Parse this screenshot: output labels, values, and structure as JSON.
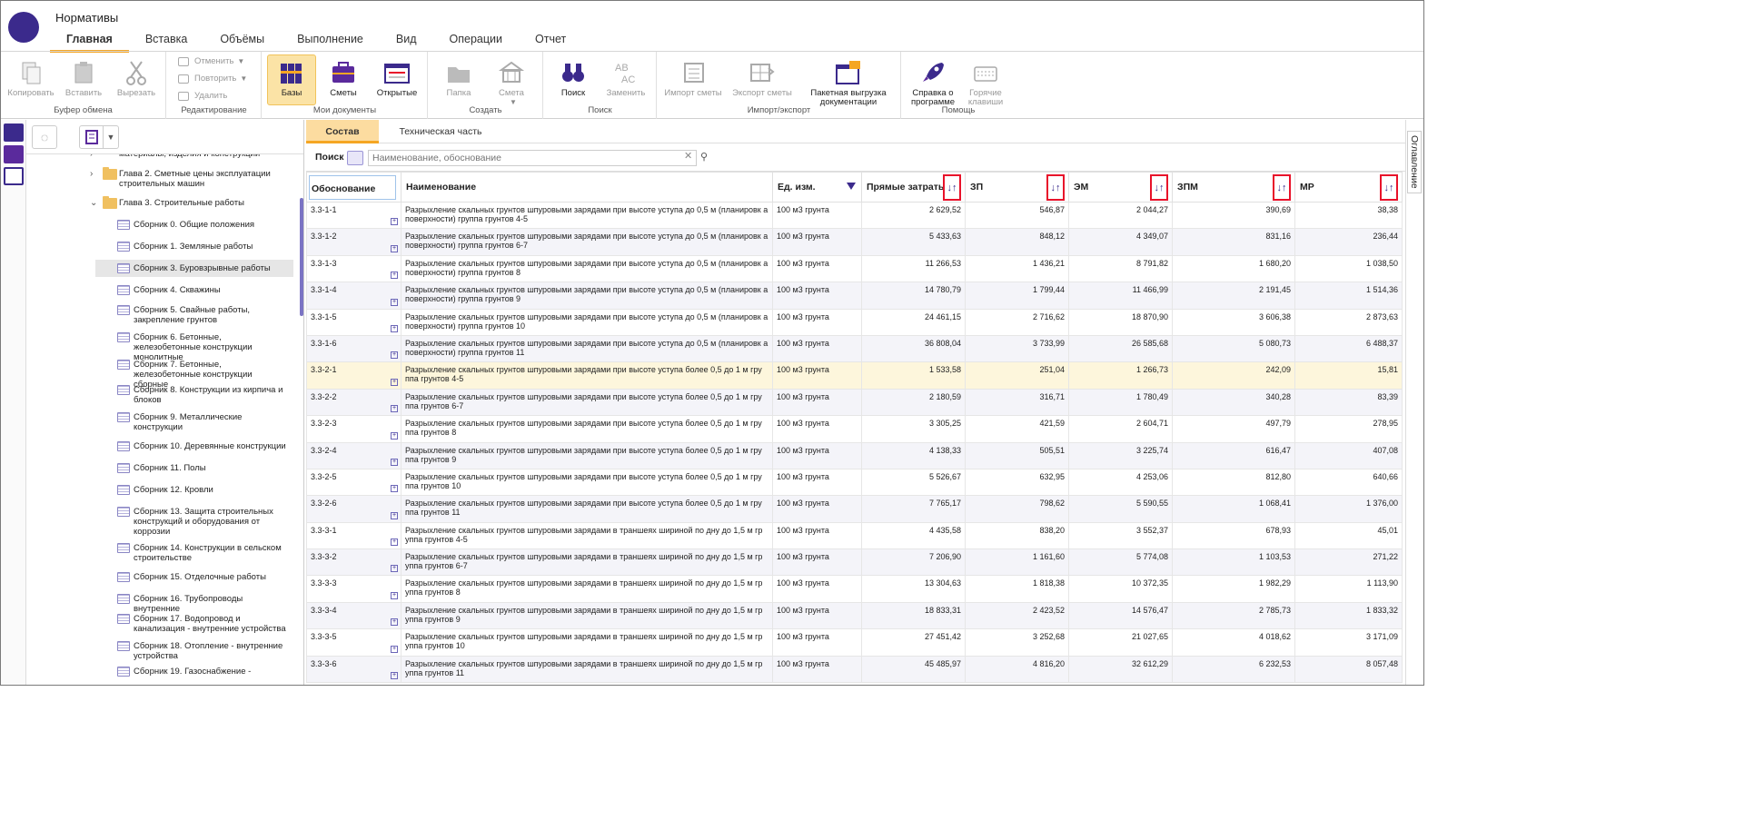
{
  "app": {
    "title": "Нормативы"
  },
  "menu": [
    "Главная",
    "Вставка",
    "Объёмы",
    "Выполнение",
    "Вид",
    "Операции",
    "Отчет"
  ],
  "ribbon": {
    "clipboard": {
      "label": "Буфер обмена",
      "copy": "Копировать",
      "paste": "Вставить",
      "cut": "Вырезать"
    },
    "edit": {
      "label": "Редактирование",
      "undo": "Отменить",
      "redo": "Повторить",
      "delete": "Удалить"
    },
    "mydocs": {
      "label": "Мои документы",
      "bases": "Базы",
      "estimates": "Сметы",
      "open": "Открытые"
    },
    "create": {
      "label": "Создать",
      "folder": "Папка",
      "estimate": "Смета"
    },
    "search": {
      "label": "Поиск",
      "find": "Поиск",
      "replace": "Заменить"
    },
    "io": {
      "label": "Импорт/экспорт",
      "import": "Импорт сметы",
      "export": "Экспорт сметы",
      "batch": "Пакетная выгрузка документации"
    },
    "help": {
      "label": "Помощь",
      "about": "Справка о программе",
      "hotkeys": "Горячие клавиши"
    }
  },
  "tree": {
    "items": [
      {
        "label": "материалы, изделия и конструкции",
        "kind": "folder-partial"
      },
      {
        "label": "Глава 2. Сметные цены эксплуатации строительных машин",
        "kind": "folder"
      },
      {
        "label": "Глава 3. Строительные работы",
        "kind": "folder-open"
      },
      {
        "label": "Сборник 0. Общие положения",
        "kind": "doc"
      },
      {
        "label": "Сборник 1. Земляные работы",
        "kind": "doc"
      },
      {
        "label": "Сборник 3. Буровзрывные работы",
        "kind": "doc",
        "selected": true
      },
      {
        "label": "Сборник 4. Скважины",
        "kind": "doc"
      },
      {
        "label": "Сборник 5. Свайные работы, закрепление грунтов",
        "kind": "doc"
      },
      {
        "label": "Сборник 6. Бетонные, железобетонные конструкции монолитные",
        "kind": "doc"
      },
      {
        "label": "Сборник 7. Бетонные, железобетонные конструкции сборные",
        "kind": "doc"
      },
      {
        "label": "Сборник 8. Конструкции из кирпича и блоков",
        "kind": "doc"
      },
      {
        "label": "Сборник 9. Металлические конструкции",
        "kind": "doc"
      },
      {
        "label": "Сборник 10. Деревянные конструкции",
        "kind": "doc"
      },
      {
        "label": "Сборник 11. Полы",
        "kind": "doc"
      },
      {
        "label": "Сборник 12. Кровли",
        "kind": "doc"
      },
      {
        "label": "Сборник 13. Защита строительных конструкций и оборудования от коррозии",
        "kind": "doc"
      },
      {
        "label": "Сборник 14. Конструкции в сельском строительстве",
        "kind": "doc"
      },
      {
        "label": "Сборник 15. Отделочные работы",
        "kind": "doc"
      },
      {
        "label": "Сборник 16. Трубопроводы внутренние",
        "kind": "doc"
      },
      {
        "label": "Сборник 17. Водопровод и канализация - внутренние устройства",
        "kind": "doc"
      },
      {
        "label": "Сборник 18. Отопление - внутренние устройства",
        "kind": "doc"
      },
      {
        "label": "Сборник 19. Газоснабжение -",
        "kind": "doc"
      }
    ]
  },
  "subtabs": [
    "Состав",
    "Техническая часть"
  ],
  "search": {
    "label": "Поиск",
    "placeholder": "Наименование, обоснование"
  },
  "table": {
    "headers": {
      "code": "Обоснование",
      "name": "Наименование",
      "unit": "Ед. изм.",
      "direct": "Прямые затраты",
      "zp": "ЗП",
      "em": "ЭМ",
      "zpm": "ЗПМ",
      "mr": "МР"
    },
    "rows": [
      {
        "code": "3.3-1-1",
        "name": "Разрыхление скальных грунтов шпуровыми зарядами при высоте уступа до 0,5 м (планировк а поверхности) группа грунтов 4-5",
        "unit": "100 м3 грунта",
        "direct": "2 629,52",
        "zp": "546,87",
        "em": "2 044,27",
        "zpm": "390,69",
        "mr": "38,38"
      },
      {
        "code": "3.3-1-2",
        "name": "Разрыхление скальных грунтов шпуровыми зарядами при высоте уступа до 0,5 м (планировк а поверхности) группа грунтов 6-7",
        "unit": "100 м3 грунта",
        "direct": "5 433,63",
        "zp": "848,12",
        "em": "4 349,07",
        "zpm": "831,16",
        "mr": "236,44"
      },
      {
        "code": "3.3-1-3",
        "name": "Разрыхление скальных грунтов шпуровыми зарядами при высоте уступа до 0,5 м (планировк а поверхности) группа грунтов 8",
        "unit": "100 м3 грунта",
        "direct": "11 266,53",
        "zp": "1 436,21",
        "em": "8 791,82",
        "zpm": "1 680,20",
        "mr": "1 038,50"
      },
      {
        "code": "3.3-1-4",
        "name": "Разрыхление скальных грунтов шпуровыми зарядами при высоте уступа до 0,5 м (планировк а поверхности) группа грунтов 9",
        "unit": "100 м3 грунта",
        "direct": "14 780,79",
        "zp": "1 799,44",
        "em": "11 466,99",
        "zpm": "2 191,45",
        "mr": "1 514,36"
      },
      {
        "code": "3.3-1-5",
        "name": "Разрыхление скальных грунтов шпуровыми зарядами при высоте уступа до 0,5 м (планировк а поверхности) группа грунтов 10",
        "unit": "100 м3 грунта",
        "direct": "24 461,15",
        "zp": "2 716,62",
        "em": "18 870,90",
        "zpm": "3 606,38",
        "mr": "2 873,63"
      },
      {
        "code": "3.3-1-6",
        "name": "Разрыхление скальных грунтов шпуровыми зарядами при высоте уступа до 0,5 м (планировк а поверхности) группа грунтов 11",
        "unit": "100 м3 грунта",
        "direct": "36 808,04",
        "zp": "3 733,99",
        "em": "26 585,68",
        "zpm": "5 080,73",
        "mr": "6 488,37"
      },
      {
        "code": "3.3-2-1",
        "name": "Разрыхление скальных грунтов шпуровыми зарядами при высоте уступа более 0,5 до 1 м гру ппа грунтов 4-5",
        "unit": "100 м3 грунта",
        "direct": "1 533,58",
        "zp": "251,04",
        "em": "1 266,73",
        "zpm": "242,09",
        "mr": "15,81"
      },
      {
        "code": "3.3-2-2",
        "name": "Разрыхление скальных грунтов шпуровыми зарядами при высоте уступа более 0,5 до 1 м гру ппа грунтов 6-7",
        "unit": "100 м3 грунта",
        "direct": "2 180,59",
        "zp": "316,71",
        "em": "1 780,49",
        "zpm": "340,28",
        "mr": "83,39"
      },
      {
        "code": "3.3-2-3",
        "name": "Разрыхление скальных грунтов шпуровыми зарядами при высоте уступа более 0,5 до 1 м гру ппа грунтов 8",
        "unit": "100 м3 грунта",
        "direct": "3 305,25",
        "zp": "421,59",
        "em": "2 604,71",
        "zpm": "497,79",
        "mr": "278,95"
      },
      {
        "code": "3.3-2-4",
        "name": "Разрыхление скальных грунтов шпуровыми зарядами при высоте уступа более 0,5 до 1 м гру ппа грунтов 9",
        "unit": "100 м3 грунта",
        "direct": "4 138,33",
        "zp": "505,51",
        "em": "3 225,74",
        "zpm": "616,47",
        "mr": "407,08"
      },
      {
        "code": "3.3-2-5",
        "name": "Разрыхление скальных грунтов шпуровыми зарядами при высоте уступа более 0,5 до 1 м гру ппа грунтов 10",
        "unit": "100 м3 грунта",
        "direct": "5 526,67",
        "zp": "632,95",
        "em": "4 253,06",
        "zpm": "812,80",
        "mr": "640,66"
      },
      {
        "code": "3.3-2-6",
        "name": "Разрыхление скальных грунтов шпуровыми зарядами при высоте уступа более 0,5 до 1 м гру ппа грунтов 11",
        "unit": "100 м3 грунта",
        "direct": "7 765,17",
        "zp": "798,62",
        "em": "5 590,55",
        "zpm": "1 068,41",
        "mr": "1 376,00"
      },
      {
        "code": "3.3-3-1",
        "name": "Разрыхление скальных грунтов шпуровыми зарядами в траншеях шириной по дну до 1,5 м гр уппа грунтов 4-5",
        "unit": "100 м3 грунта",
        "direct": "4 435,58",
        "zp": "838,20",
        "em": "3 552,37",
        "zpm": "678,93",
        "mr": "45,01"
      },
      {
        "code": "3.3-3-2",
        "name": "Разрыхление скальных грунтов шпуровыми зарядами в траншеях шириной по дну до 1,5 м гр уппа грунтов 6-7",
        "unit": "100 м3 грунта",
        "direct": "7 206,90",
        "zp": "1 161,60",
        "em": "5 774,08",
        "zpm": "1 103,53",
        "mr": "271,22"
      },
      {
        "code": "3.3-3-3",
        "name": "Разрыхление скальных грунтов шпуровыми зарядами в траншеях шириной по дну до 1,5 м гр уппа грунтов 8",
        "unit": "100 м3 грунта",
        "direct": "13 304,63",
        "zp": "1 818,38",
        "em": "10 372,35",
        "zpm": "1 982,29",
        "mr": "1 113,90"
      },
      {
        "code": "3.3-3-4",
        "name": "Разрыхление скальных грунтов шпуровыми зарядами в траншеях шириной по дну до 1,5 м гр уппа грунтов 9",
        "unit": "100 м3 грунта",
        "direct": "18 833,31",
        "zp": "2 423,52",
        "em": "14 576,47",
        "zpm": "2 785,73",
        "mr": "1 833,32"
      },
      {
        "code": "3.3-3-5",
        "name": "Разрыхление скальных грунтов шпуровыми зарядами в траншеях шириной по дну до 1,5 м гр уппа грунтов 10",
        "unit": "100 м3 грунта",
        "direct": "27 451,42",
        "zp": "3 252,68",
        "em": "21 027,65",
        "zpm": "4 018,62",
        "mr": "3 171,09"
      },
      {
        "code": "3.3-3-6",
        "name": "Разрыхление скальных грунтов шпуровыми зарядами в траншеях шириной по дну до 1,5 м гр уппа грунтов 11",
        "unit": "100 м3 грунта",
        "direct": "45 485,97",
        "zp": "4 816,20",
        "em": "32 612,29",
        "zpm": "6 232,53",
        "mr": "8 057,48"
      }
    ]
  },
  "right_sidebar": {
    "label": "Оглавление"
  },
  "colors": {
    "accent": "#f5a623",
    "brand": "#3b2a8c",
    "sort_border": "#e8122a"
  }
}
